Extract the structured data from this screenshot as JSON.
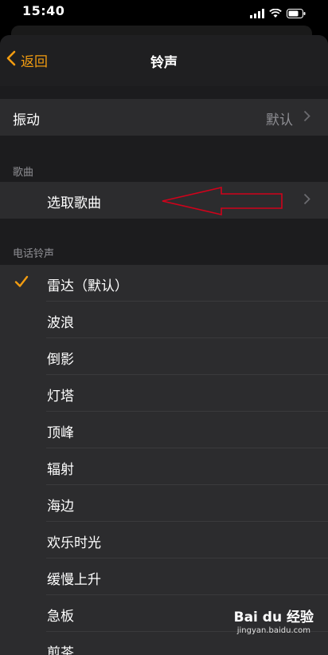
{
  "status": {
    "time": "15:40"
  },
  "nav": {
    "back_label": "返回",
    "title": "铃声"
  },
  "vibration": {
    "label": "振动",
    "value": "默认"
  },
  "songs_section": {
    "header": "歌曲",
    "pick_song_label": "选取歌曲"
  },
  "ringtones_section": {
    "header": "电话铃声",
    "items": [
      {
        "label": "雷达（默认）",
        "selected": true
      },
      {
        "label": "波浪"
      },
      {
        "label": "倒影"
      },
      {
        "label": "灯塔"
      },
      {
        "label": "顶峰"
      },
      {
        "label": "辐射"
      },
      {
        "label": "海边"
      },
      {
        "label": "欢乐时光"
      },
      {
        "label": "缓慢上升"
      },
      {
        "label": "急板"
      },
      {
        "label": "煎茶"
      }
    ]
  },
  "watermark": {
    "brand": "Bai du 经验",
    "url": "jingyan.baidu.com"
  },
  "colors": {
    "accent": "#f29c11",
    "annotation_arrow": "#d0021b"
  }
}
